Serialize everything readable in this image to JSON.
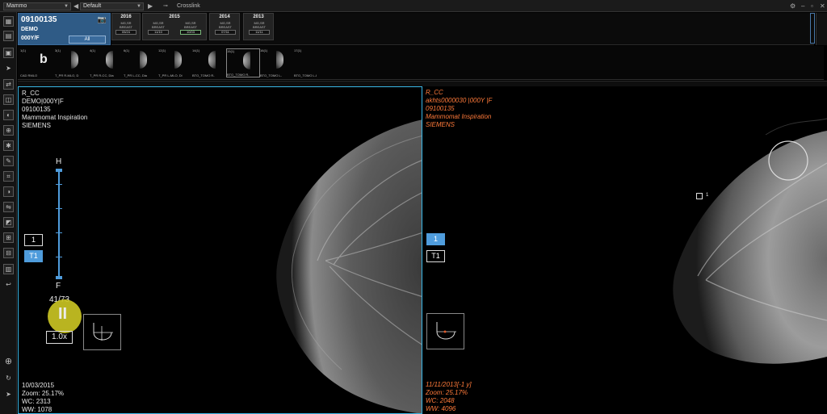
{
  "topbar": {
    "protocol_select": "Mammo",
    "layout_select": "Default",
    "crosslink_icon": "crosslink-icon",
    "crosslink_label": "Crosslink"
  },
  "patient": {
    "id": "09100135",
    "name": "DEMO",
    "age_sex": "000Y/F",
    "all_label": "All"
  },
  "studies": [
    {
      "year": "2016",
      "cells": [
        {
          "mod": "MG,SR",
          "body": "BREAST",
          "date": "05/24"
        }
      ]
    },
    {
      "year": "2015",
      "cells": [
        {
          "mod": "MG,SR",
          "body": "BREAST",
          "date": "11/10"
        },
        {
          "mod": "MG,SR",
          "body": "BREAST",
          "date": "10/03"
        }
      ]
    },
    {
      "year": "2014",
      "cells": [
        {
          "mod": "MG,SR",
          "body": "BREAST",
          "date": "07/11"
        }
      ]
    },
    {
      "year": "2013",
      "cells": [
        {
          "mod": "MG,SR",
          "body": "BREAST",
          "date": "11/11"
        }
      ]
    }
  ],
  "thumbnails": [
    {
      "num": "1(1)",
      "label": "CAD RMLO",
      "overlay": "b"
    },
    {
      "num": "3(1)",
      "label": "T_PR R-MLO, D"
    },
    {
      "num": "4(1)",
      "label": "T_PR R-CC, Dia"
    },
    {
      "num": "6(1)",
      "label": "T_PR L-CC, Dia"
    },
    {
      "num": "12(1)",
      "label": "T_PR L-MLO, Di"
    },
    {
      "num": "14(1)",
      "label": "BTO_TOMO R-"
    },
    {
      "num": "15(1)",
      "label": "BTO_TOMO R-"
    },
    {
      "num": "16(1)",
      "label": "BTO_TOMO L-"
    },
    {
      "num": "17(1)",
      "label": "BTO_TOMO L-I"
    }
  ],
  "left_view": {
    "view": "R_CC",
    "patient_line": "DEMO|000Y|F",
    "id": "09100135",
    "device": "Mammomat Inspiration",
    "maker": "SIEMENS",
    "ruler_top": "H",
    "ruler_bottom": "F",
    "slice": "41/73",
    "frame_num": "1",
    "frame_tag": "T1",
    "zoom_factor": "1.0x",
    "date": "10/03/2015",
    "zoom": "Zoom: 25.17%",
    "wc": "WC: 2313",
    "ww": "WW: 1078"
  },
  "right_view": {
    "view": "R_CC",
    "patient_line": "akhts0000030 |000Y |F",
    "id": "09100135",
    "device": "Mammomat Inspiration",
    "maker": "SIEMENS",
    "marker_num": "1",
    "frame_num": "1",
    "frame_tag": "T1",
    "date": "11/11/2013[-1 y]",
    "zoom": "Zoom: 25.17%",
    "wc": "WC: 2048",
    "ww": "WW: 4096"
  },
  "icons": {
    "left_toolbar": [
      "grid-layout-icon",
      "series-icon",
      "image-layout-icon",
      "pointer-icon",
      "sync-icon",
      "compare-icon",
      "window-level-icon",
      "zoom-icon",
      "magnify-icon",
      "annotate-icon",
      "crop-icon",
      "invert-icon",
      "flip-icon",
      "grid-icon",
      "hanging-protocol-icon",
      "undo-icon",
      "target-icon",
      "rotate-icon",
      "cursor-icon"
    ]
  }
}
